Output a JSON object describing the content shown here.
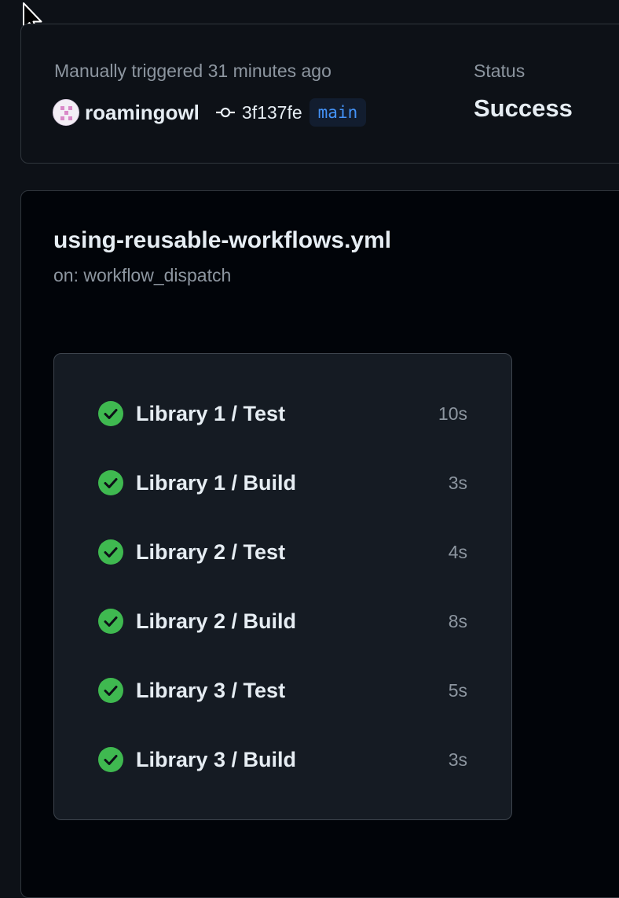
{
  "summary": {
    "trigger_text": "Manually triggered 31 minutes ago",
    "username": "roamingowl",
    "commit_sha": "3f137fe",
    "branch": "main",
    "status_label": "Status",
    "status_value": "Success"
  },
  "workflow": {
    "file_name": "using-reusable-workflows.yml",
    "trigger": "on: workflow_dispatch"
  },
  "jobs": [
    {
      "name": "Library 1 / Test",
      "duration": "10s",
      "status": "success"
    },
    {
      "name": "Library 1 / Build",
      "duration": "3s",
      "status": "success"
    },
    {
      "name": "Library 2 / Test",
      "duration": "4s",
      "status": "success"
    },
    {
      "name": "Library 2 / Build",
      "duration": "8s",
      "status": "success"
    },
    {
      "name": "Library 3 / Test",
      "duration": "5s",
      "status": "success"
    },
    {
      "name": "Library 3 / Build",
      "duration": "3s",
      "status": "success"
    }
  ],
  "icons": {
    "cursor": "mouse-pointer-icon",
    "commit": "git-commit-icon",
    "job_status": "check-circle-fill-icon"
  },
  "colors": {
    "background": "#0d1117",
    "success": "#3fb950",
    "branch_text": "#4493f8",
    "muted_text": "#8d96a0"
  }
}
